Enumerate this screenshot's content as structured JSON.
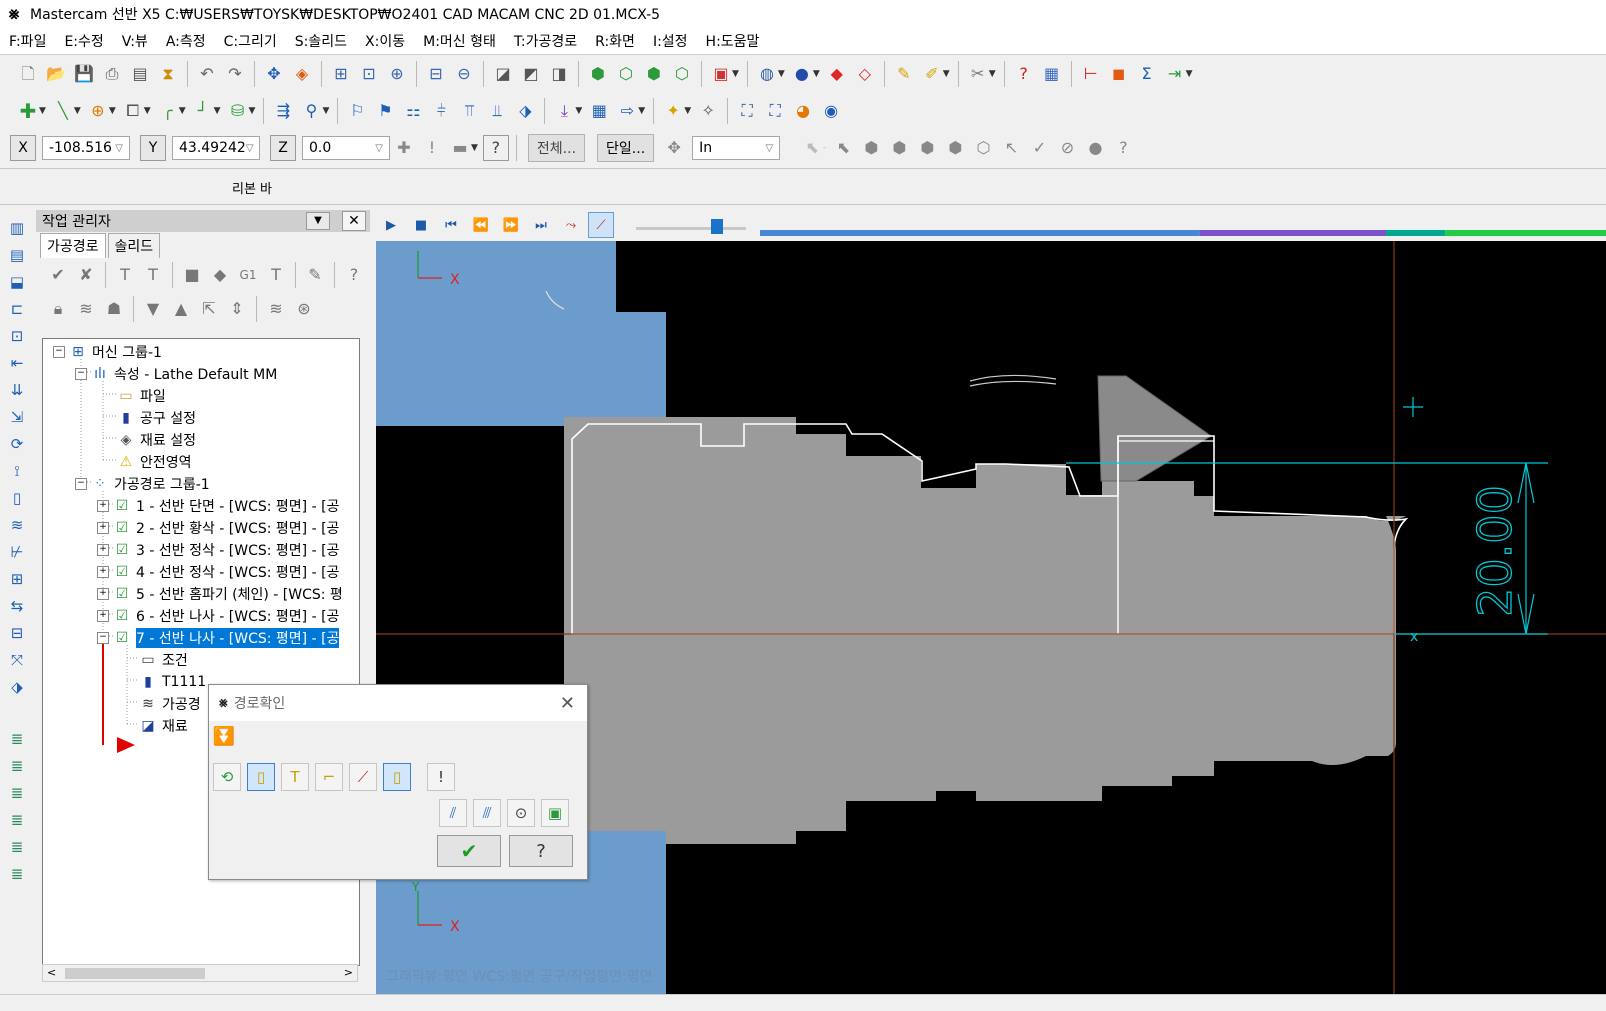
{
  "window": {
    "title": "Mastercam 선반 X5  C:₩USERS₩TOYSK₩DESKTOP₩O2401 CAD MACAM CNC 2D 01.MCX-5"
  },
  "menu": [
    "F:파일",
    "E:수정",
    "V:뷰",
    "A:측정",
    "C:그리기",
    "S:솔리드",
    "X:이동",
    "M:머신 형태",
    "T:가공경로",
    "R:화면",
    "I:설정",
    "H:도움말"
  ],
  "coords": {
    "x_label": "X",
    "x_value": "-108.516",
    "y_label": "Y",
    "y_value": "43.49242",
    "z_label": "Z",
    "z_value": "0.0"
  },
  "general": {
    "all_label": "전체...",
    "single_label": "단일...",
    "units_value": "In"
  },
  "ribbon_label": "리본 바",
  "op_manager": {
    "title": "작업 관리자",
    "tabs": [
      "가공경로",
      "솔리드"
    ],
    "tree": {
      "machine_group": "머신 그룹-1",
      "properties": "속성 - Lathe Default MM",
      "files": "파일",
      "tool_settings": "공구 설정",
      "stock_setup": "재료 설정",
      "safety_zone": "안전영역",
      "toolpath_group": "가공경로 그룹-1",
      "operations": [
        "1 - 선반 단면 - [WCS: 평면] - [공",
        "2 - 선반 황삭 - [WCS: 평면] - [공",
        "3 - 선반 정삭 - [WCS: 평면] - [공",
        "4 - 선반 정삭 - [WCS: 평면] - [공",
        "5 - 선반 홈파기 (체인) - [WCS: 평",
        "6 - 선반 나사 - [WCS: 평면] - [공",
        "7 - 선반 나사 - [WCS: 평면] - [공"
      ],
      "op7_children": [
        "조건",
        "T1111",
        "가공경",
        "재료"
      ]
    }
  },
  "dialog": {
    "title": "경로확인"
  },
  "viewport": {
    "status": "그래픽뷰:평면   WCS:평면   공구/작업평면:평면",
    "dimension": "20.00",
    "axis_x": "X",
    "axis_y": "Y",
    "colors": {
      "background": "#000000",
      "stock": "#9b9b9b",
      "chuck": "#6b9ccc",
      "dimension": "#00c8d4",
      "centerline": "#8a3a12"
    }
  },
  "playback": {
    "position_percent": 77,
    "progress_segments": [
      "#4a86d8",
      "#7b52c8",
      "#00a890",
      "#22cc44"
    ]
  }
}
